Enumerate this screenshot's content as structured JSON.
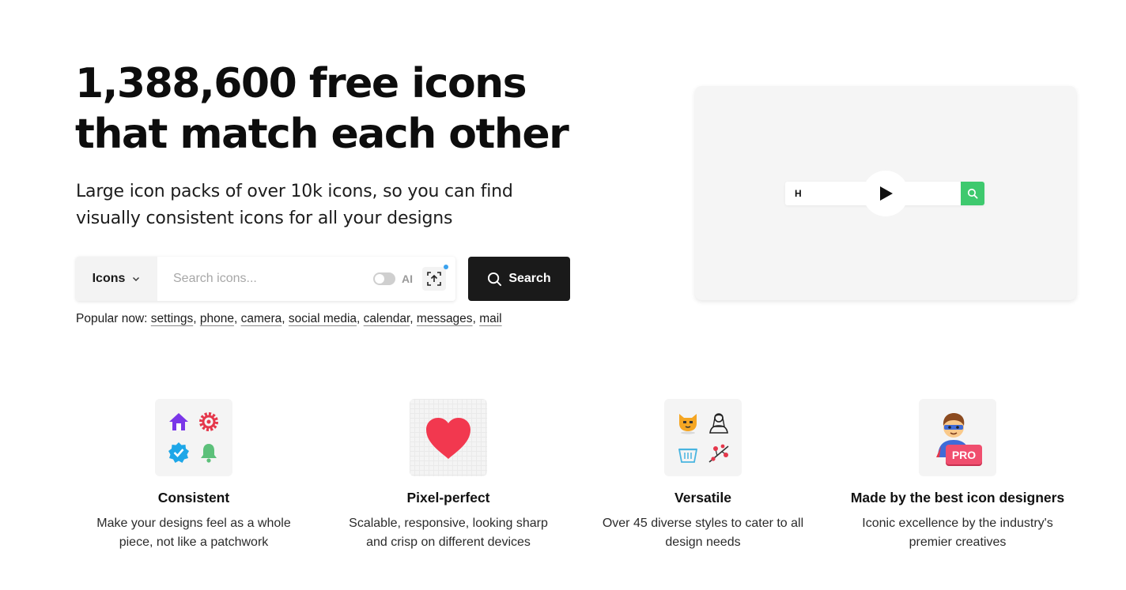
{
  "hero": {
    "title_line1": "1,388,600 free icons",
    "title_line2": "that match each other",
    "subtitle_line1": "Large icon packs of over 10k icons, so you can find",
    "subtitle_line2": "visually consistent icons for all your designs"
  },
  "search": {
    "type_label": "Icons",
    "placeholder": "Search icons...",
    "ai_label": "AI",
    "ai_enabled": false,
    "button_label": "Search"
  },
  "popular": {
    "prefix": "Popular now:",
    "items": [
      "settings",
      "phone",
      "camera",
      "social media",
      "calendar",
      "messages",
      "mail"
    ]
  },
  "video": {
    "typed_text": "H"
  },
  "features": [
    {
      "title": "Consistent",
      "text_line1": "Make your designs feel as a whole",
      "text_line2": "piece, not like a patchwork"
    },
    {
      "title": "Pixel-perfect",
      "text_line1": "Scalable, responsive, looking sharp",
      "text_line2": "and crisp on different devices"
    },
    {
      "title": "Versatile",
      "text_line1": "Over 45 diverse styles to cater to all",
      "text_line2": "design needs"
    },
    {
      "title": "Made by the best icon designers",
      "text_line1": "Iconic excellence by the industry's",
      "text_line2": "premier creatives",
      "badge": "PRO"
    }
  ],
  "colors": {
    "search_button": "#1a1a1a",
    "mini_search": "#3ec96e",
    "heart": "#f2384f",
    "pro_badge": "#f04e6e",
    "upload_dot": "#3ba2ee"
  }
}
